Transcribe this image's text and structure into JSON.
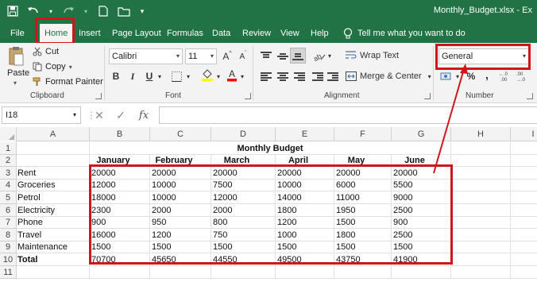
{
  "window": {
    "title": "Monthly_Budget.xlsx - Ex"
  },
  "tabs": [
    "File",
    "Home",
    "Insert",
    "Page Layout",
    "Formulas",
    "Data",
    "Review",
    "View",
    "Help"
  ],
  "tell_me": "Tell me what you want to do",
  "ribbon": {
    "clipboard": {
      "paste": "Paste",
      "cut": "Cut",
      "copy": "Copy",
      "format_painter": "Format Painter",
      "label": "Clipboard"
    },
    "font": {
      "name": "Calibri",
      "size": "11",
      "grow": "A",
      "shrink": "A",
      "bold": "B",
      "italic": "I",
      "underline": "U",
      "label": "Font",
      "fill_color": "#ffff00",
      "font_color": "#ff0000"
    },
    "alignment": {
      "wrap_text": "Wrap Text",
      "merge_center": "Merge & Center",
      "label": "Alignment"
    },
    "number": {
      "format": "General",
      "percent": "%",
      "comma": ",",
      "label": "Number"
    }
  },
  "formula_bar": {
    "name_box": "I18",
    "fx": "fx",
    "formula": ""
  },
  "sheet": {
    "columns": [
      "A",
      "B",
      "C",
      "D",
      "E",
      "F",
      "G",
      "H",
      "I"
    ],
    "rows": [
      "1",
      "2",
      "3",
      "4",
      "5",
      "6",
      "7",
      "8",
      "9",
      "10",
      "11"
    ],
    "title": "Monthly Budget",
    "months": [
      "January",
      "February",
      "March",
      "April",
      "May",
      "June"
    ],
    "data": [
      {
        "label": "Rent",
        "values": [
          "20000",
          "20000",
          "20000",
          "20000",
          "20000",
          "20000"
        ]
      },
      {
        "label": "Groceries",
        "values": [
          "12000",
          "10000",
          "7500",
          "10000",
          "6000",
          "5500"
        ]
      },
      {
        "label": "Petrol",
        "values": [
          "18000",
          "10000",
          "12000",
          "14000",
          "11000",
          "9000"
        ]
      },
      {
        "label": "Electricity",
        "values": [
          "2300",
          "2000",
          "2000",
          "1800",
          "1950",
          "2500"
        ]
      },
      {
        "label": "Phone",
        "values": [
          "900",
          "950",
          "800",
          "1200",
          "1500",
          "900"
        ]
      },
      {
        "label": "Travel",
        "values": [
          "16000",
          "1200",
          "750",
          "1000",
          "1800",
          "2500"
        ]
      },
      {
        "label": "Maintenance",
        "values": [
          "1500",
          "1500",
          "1500",
          "1500",
          "1500",
          "1500"
        ]
      },
      {
        "label": "Total",
        "values": [
          "70700",
          "45650",
          "44550",
          "49500",
          "43750",
          "41900"
        ]
      }
    ]
  },
  "colors": {
    "accent": "#217346",
    "highlight": "#d0161a"
  }
}
